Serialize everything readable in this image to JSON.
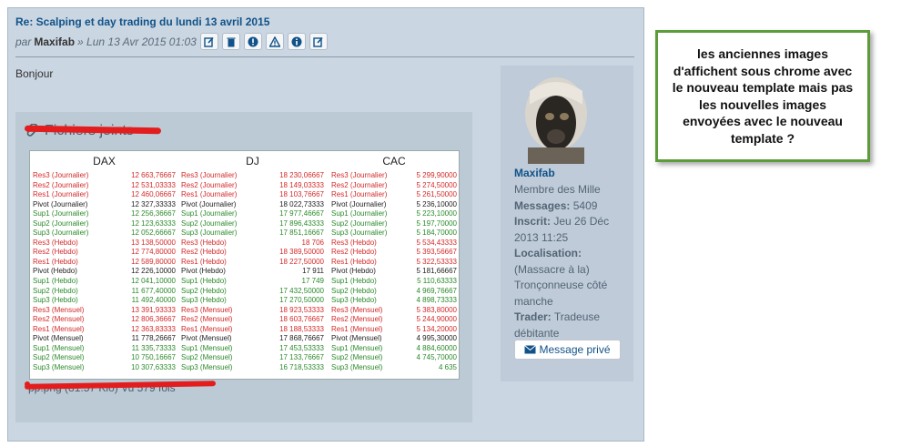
{
  "post": {
    "title": "Re: Scalping et day trading du lundi 13 avril 2015",
    "by_prefix": "par",
    "author": "Maxifab",
    "date": "» Lun 13 Avr 2015 01:03",
    "body": "Bonjour"
  },
  "attachments": {
    "title": "Fichiers joints",
    "filename": "pp.png (81.57 Kio) Vu 579 fois"
  },
  "indices": {
    "columns": [
      {
        "name": "DAX",
        "rows": [
          {
            "label": "Res3 (Journalier)",
            "value": "12 663,76667",
            "kind": "res"
          },
          {
            "label": "Res2 (Journalier)",
            "value": "12 531,03333",
            "kind": "res"
          },
          {
            "label": "Res1 (Journalier)",
            "value": "12 460,06667",
            "kind": "res"
          },
          {
            "label": "Pivot (Journalier)",
            "value": "12 327,33333",
            "kind": "piv"
          },
          {
            "label": "Sup1 (Journalier)",
            "value": "12 256,36667",
            "kind": "sup"
          },
          {
            "label": "Sup2 (Journalier)",
            "value": "12 123,63333",
            "kind": "sup"
          },
          {
            "label": "Sup3 (Journalier)",
            "value": "12 052,66667",
            "kind": "sup"
          },
          {
            "label": "Res3 (Hebdo)",
            "value": "13 138,50000",
            "kind": "res"
          },
          {
            "label": "Res2 (Hebdo)",
            "value": "12 774,80000",
            "kind": "res"
          },
          {
            "label": "Res1 (Hebdo)",
            "value": "12 589,80000",
            "kind": "res"
          },
          {
            "label": "Pivot (Hebdo)",
            "value": "12 226,10000",
            "kind": "piv"
          },
          {
            "label": "Sup1 (Hebdo)",
            "value": "12 041,10000",
            "kind": "sup"
          },
          {
            "label": "Sup2 (Hebdo)",
            "value": "11 677,40000",
            "kind": "sup"
          },
          {
            "label": "Sup3 (Hebdo)",
            "value": "11 492,40000",
            "kind": "sup"
          },
          {
            "label": "Res3 (Mensuel)",
            "value": "13 391,93333",
            "kind": "res"
          },
          {
            "label": "Res2 (Mensuel)",
            "value": "12 806,36667",
            "kind": "res"
          },
          {
            "label": "Res1 (Mensuel)",
            "value": "12 363,83333",
            "kind": "res"
          },
          {
            "label": "Pivot (Mensuel)",
            "value": "11 778,26667",
            "kind": "piv"
          },
          {
            "label": "Sup1 (Mensuel)",
            "value": "11 335,73333",
            "kind": "sup"
          },
          {
            "label": "Sup2 (Mensuel)",
            "value": "10 750,16667",
            "kind": "sup"
          },
          {
            "label": "Sup3 (Mensuel)",
            "value": "10 307,63333",
            "kind": "sup"
          }
        ]
      },
      {
        "name": "DJ",
        "rows": [
          {
            "label": "Res3 (Journalier)",
            "value": "18 230,06667",
            "kind": "res"
          },
          {
            "label": "Res2 (Journalier)",
            "value": "18 149,03333",
            "kind": "res"
          },
          {
            "label": "Res1 (Journalier)",
            "value": "18 103,76667",
            "kind": "res"
          },
          {
            "label": "Pivot (Journalier)",
            "value": "18 022,73333",
            "kind": "piv"
          },
          {
            "label": "Sup1 (Journalier)",
            "value": "17 977,46667",
            "kind": "sup"
          },
          {
            "label": "Sup2 (Journalier)",
            "value": "17 896,43333",
            "kind": "sup"
          },
          {
            "label": "Sup3 (Journalier)",
            "value": "17 851,16667",
            "kind": "sup"
          },
          {
            "label": "Res3 (Hebdo)",
            "value": "18 706",
            "kind": "res"
          },
          {
            "label": "Res2 (Hebdo)",
            "value": "18 389,50000",
            "kind": "res"
          },
          {
            "label": "Res1 (Hebdo)",
            "value": "18 227,50000",
            "kind": "res"
          },
          {
            "label": "Pivot (Hebdo)",
            "value": "17 911",
            "kind": "piv"
          },
          {
            "label": "Sup1 (Hebdo)",
            "value": "17 749",
            "kind": "sup"
          },
          {
            "label": "Sup2 (Hebdo)",
            "value": "17 432,50000",
            "kind": "sup"
          },
          {
            "label": "Sup3 (Hebdo)",
            "value": "17 270,50000",
            "kind": "sup"
          },
          {
            "label": "Res3 (Mensuel)",
            "value": "18 923,53333",
            "kind": "res"
          },
          {
            "label": "Res2 (Mensuel)",
            "value": "18 603,76667",
            "kind": "res"
          },
          {
            "label": "Res1 (Mensuel)",
            "value": "18 188,53333",
            "kind": "res"
          },
          {
            "label": "Pivot (Mensuel)",
            "value": "17 868,76667",
            "kind": "piv"
          },
          {
            "label": "Sup1 (Mensuel)",
            "value": "17 453,53333",
            "kind": "sup"
          },
          {
            "label": "Sup2 (Mensuel)",
            "value": "17 133,76667",
            "kind": "sup"
          },
          {
            "label": "Sup3 (Mensuel)",
            "value": "16 718,53333",
            "kind": "sup"
          }
        ]
      },
      {
        "name": "CAC",
        "rows": [
          {
            "label": "Res3 (Journalier)",
            "value": "5 299,90000",
            "kind": "res"
          },
          {
            "label": "Res2 (Journalier)",
            "value": "5 274,50000",
            "kind": "res"
          },
          {
            "label": "Res1 (Journalier)",
            "value": "5 261,50000",
            "kind": "res"
          },
          {
            "label": "Pivot (Journalier)",
            "value": "5 236,10000",
            "kind": "piv"
          },
          {
            "label": "Sup1 (Journalier)",
            "value": "5 223,10000",
            "kind": "sup"
          },
          {
            "label": "Sup2 (Journalier)",
            "value": "5 197,70000",
            "kind": "sup"
          },
          {
            "label": "Sup3 (Journalier)",
            "value": "5 184,70000",
            "kind": "sup"
          },
          {
            "label": "Res3 (Hebdo)",
            "value": "5 534,43333",
            "kind": "res"
          },
          {
            "label": "Res2 (Hebdo)",
            "value": "5 393,56667",
            "kind": "res"
          },
          {
            "label": "Res1 (Hebdo)",
            "value": "5 322,53333",
            "kind": "res"
          },
          {
            "label": "Pivot (Hebdo)",
            "value": "5 181,66667",
            "kind": "piv"
          },
          {
            "label": "Sup1 (Hebdo)",
            "value": "5 110,63333",
            "kind": "sup"
          },
          {
            "label": "Sup2 (Hebdo)",
            "value": "4 969,76667",
            "kind": "sup"
          },
          {
            "label": "Sup3 (Hebdo)",
            "value": "4 898,73333",
            "kind": "sup"
          },
          {
            "label": "Res3 (Mensuel)",
            "value": "5 383,80000",
            "kind": "res"
          },
          {
            "label": "Res2 (Mensuel)",
            "value": "5 244,90000",
            "kind": "res"
          },
          {
            "label": "Res1 (Mensuel)",
            "value": "5 134,20000",
            "kind": "res"
          },
          {
            "label": "Pivot (Mensuel)",
            "value": "4 995,30000",
            "kind": "piv"
          },
          {
            "label": "Sup1 (Mensuel)",
            "value": "4 884,60000",
            "kind": "sup"
          },
          {
            "label": "Sup2 (Mensuel)",
            "value": "4 745,70000",
            "kind": "sup"
          },
          {
            "label": "Sup3 (Mensuel)",
            "value": "4 635",
            "kind": "sup"
          }
        ]
      }
    ]
  },
  "profile": {
    "username": "Maxifab",
    "rank": "Membre des Mille",
    "messages_label": "Messages:",
    "messages_value": "5409",
    "joined_label": "Inscrit:",
    "joined_value": "Jeu 26 Déc 2013 11:25",
    "location_label": "Localisation:",
    "location_value": "(Massacre à la) Tronçonneuse côté manche",
    "trader_label": "Trader:",
    "trader_value": "Tradeuse débitante",
    "pm_label": "Message privé"
  },
  "note": "les anciennes images d'affichent sous chrome avec le nouveau template mais pas les nouvelles images envoyées avec le nouveau template ?",
  "colors": {
    "res": "#d42a2a",
    "pivot": "#222222",
    "sup": "#2b8a2b",
    "link": "#105289",
    "note_border": "#5d9c3a"
  }
}
